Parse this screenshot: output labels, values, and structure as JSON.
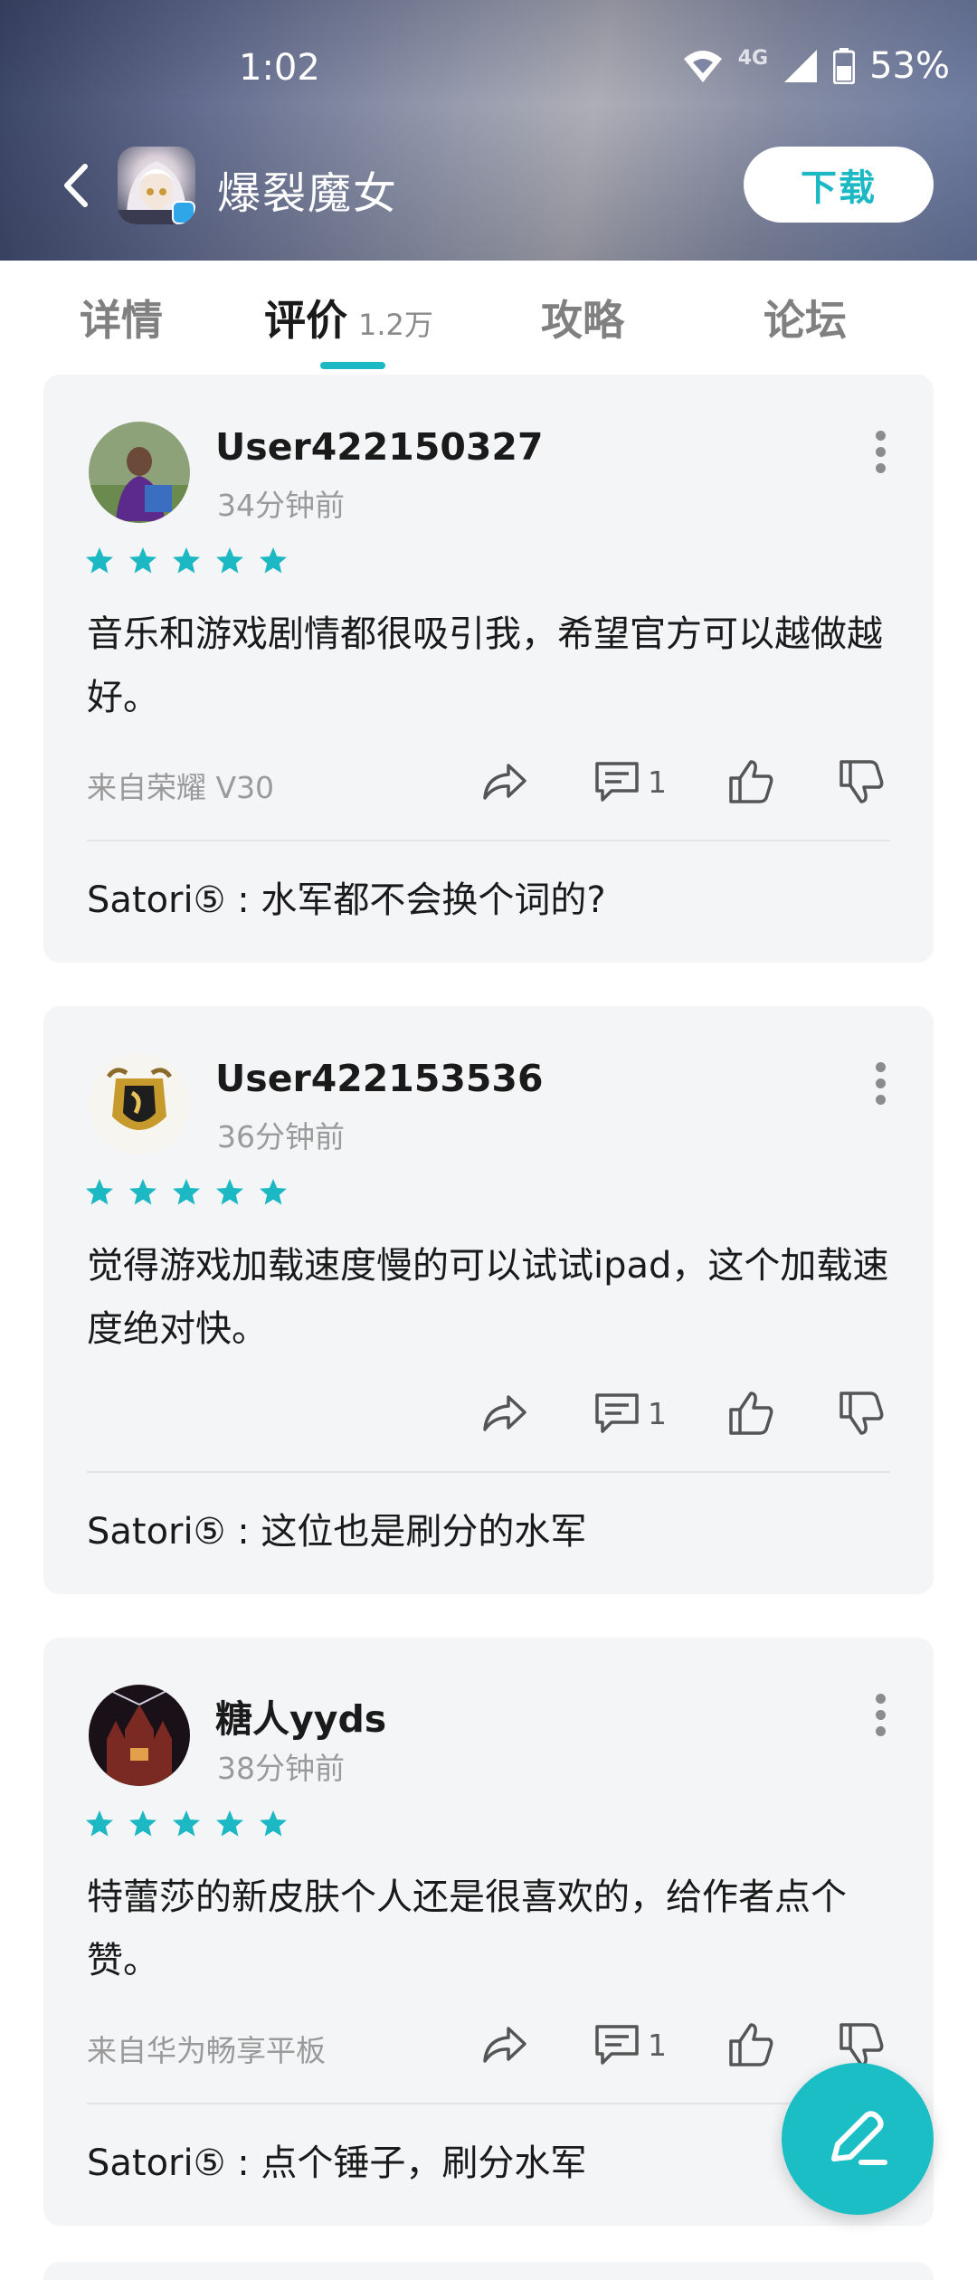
{
  "status_bar": {
    "time": "1:02",
    "network": "4G",
    "battery": "53%"
  },
  "header": {
    "app_title": "爆裂魔女",
    "download_label": "下载",
    "accent_color": "#1cb9c4"
  },
  "tabs": [
    {
      "label": "详情"
    },
    {
      "label": "评价",
      "count": "1.2万",
      "active": true
    },
    {
      "label": "攻略"
    },
    {
      "label": "论坛"
    }
  ],
  "reviews": [
    {
      "username": "User422150327",
      "time": "34分钟前",
      "stars": 5,
      "text": "音乐和游戏剧情都很吸引我，希望官方可以越做越好。",
      "device": "来自荣耀 V30",
      "comment_count": "1",
      "reply": "Satori⑤ : 水军都不会换个词的?"
    },
    {
      "username": "User422153536",
      "time": "36分钟前",
      "stars": 5,
      "text": "觉得游戏加载速度慢的可以试试ipad，这个加载速度绝对快。",
      "device": "",
      "comment_count": "1",
      "reply": "Satori⑤ : 这位也是刷分的水军"
    },
    {
      "username": "糖人yyds",
      "time": "38分钟前",
      "stars": 5,
      "text": "特蕾莎的新皮肤个人还是很喜欢的，给作者点个赞。",
      "device": "来自华为畅享平板",
      "comment_count": "1",
      "reply": "Satori⑤ : 点个锤子，刷分水军"
    }
  ]
}
